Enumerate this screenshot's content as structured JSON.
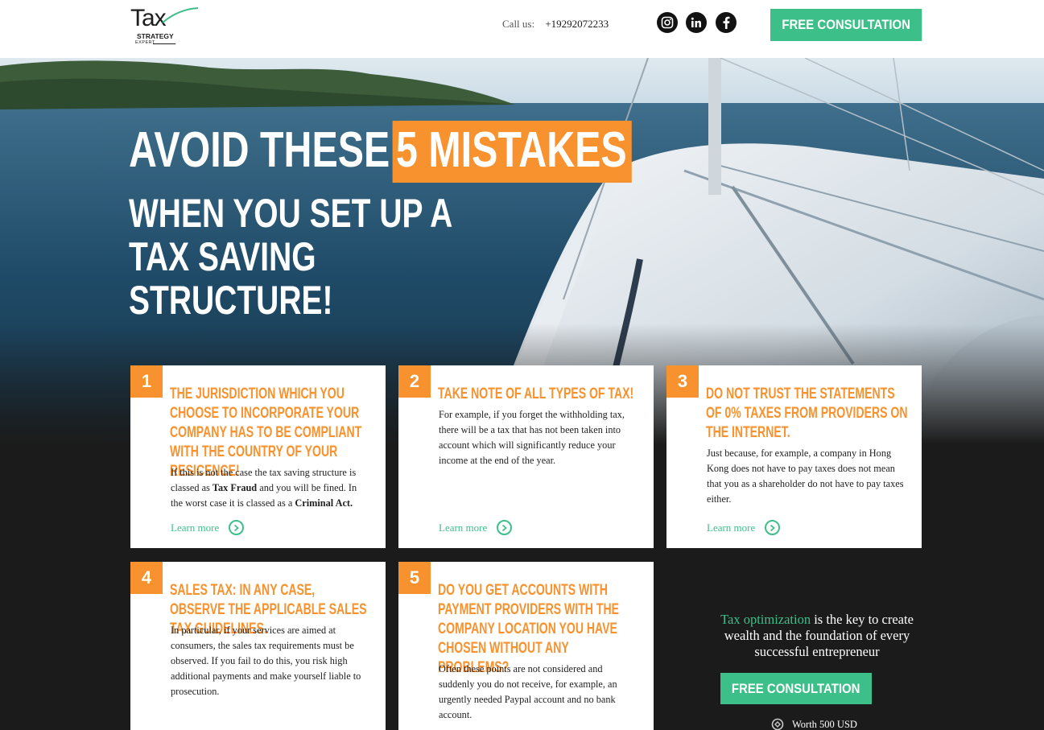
{
  "brand": {
    "logo_word": "Tax",
    "logo_strategy": "STRATEGY",
    "logo_expert": "EXPERT",
    "accent_orange": "#f7922e",
    "accent_green": "#3dbf8a"
  },
  "header": {
    "call_label": "Call us:",
    "phone": "+19292072233",
    "social_icons": [
      "instagram-icon",
      "linkedin-icon",
      "facebook-icon"
    ],
    "cta_label": "FREE CONSULTATION"
  },
  "hero": {
    "headline_prefix": "AVOID THESE",
    "headline_highlight": "5 MISTAKES",
    "headline_line2": "WHEN YOU SET UP A",
    "headline_line3": "TAX SAVING",
    "headline_line4": "STRUCTURE!"
  },
  "cards": [
    {
      "number": "1",
      "title": "THE JURISDICTION WHICH YOU CHOOSE TO INCORPORATE YOUR COMPANY HAS TO BE COMPLIANT WITH THE COUNTRY OF YOUR RESICENCE!",
      "body_1": "If this is not the case the tax saving structure is classed as ",
      "body_bold_1": "Tax Fraud",
      "body_2": " and you will be fined. In the worst case it is classed as a ",
      "body_bold_2": "Criminal Act.",
      "link": "Learn more"
    },
    {
      "number": "2",
      "title": "TAKE NOTE OF ALL TYPES OF TAX!",
      "body": "For example, if you forget the withholding tax, there will be a tax that has not been taken into account which will significantly reduce your income at the end of the year.",
      "link": "Learn more"
    },
    {
      "number": "3",
      "title": "DO NOT TRUST THE STATEMENTS OF 0% TAXES FROM PROVIDERS ON THE INTERNET.",
      "body": "Just because, for example, a company in Hong Kong does not have to pay taxes does not mean that you as a shareholder do not have to pay taxes either.",
      "link": "Learn more"
    },
    {
      "number": "4",
      "title": "SALES TAX: IN ANY CASE, OBSERVE THE APPLICABLE SALES TAX GUIDELINES.",
      "body": "In particular, if your services are aimed at consumers, the sales tax requirements must be observed. If you fail to do this, you risk high additional payments and make yourself liable to prosecution."
    },
    {
      "number": "5",
      "title": "DO YOU GET ACCOUNTS WITH PAYMENT PROVIDERS WITH THE COMPANY LOCATION YOU HAVE CHOSEN WITHOUT ANY PROBLEMS?",
      "body": "Often these points are not considered and suddenly you do not receive, for example, an urgently needed Paypal account and no bank account."
    }
  ],
  "side": {
    "tagline_highlight": "Tax optimization",
    "tagline_rest": " is the key to create wealth and the foundation of every successful entrepreneur",
    "cta_label": "FREE CONSULTATION",
    "worth": "Worth 500 USD"
  }
}
